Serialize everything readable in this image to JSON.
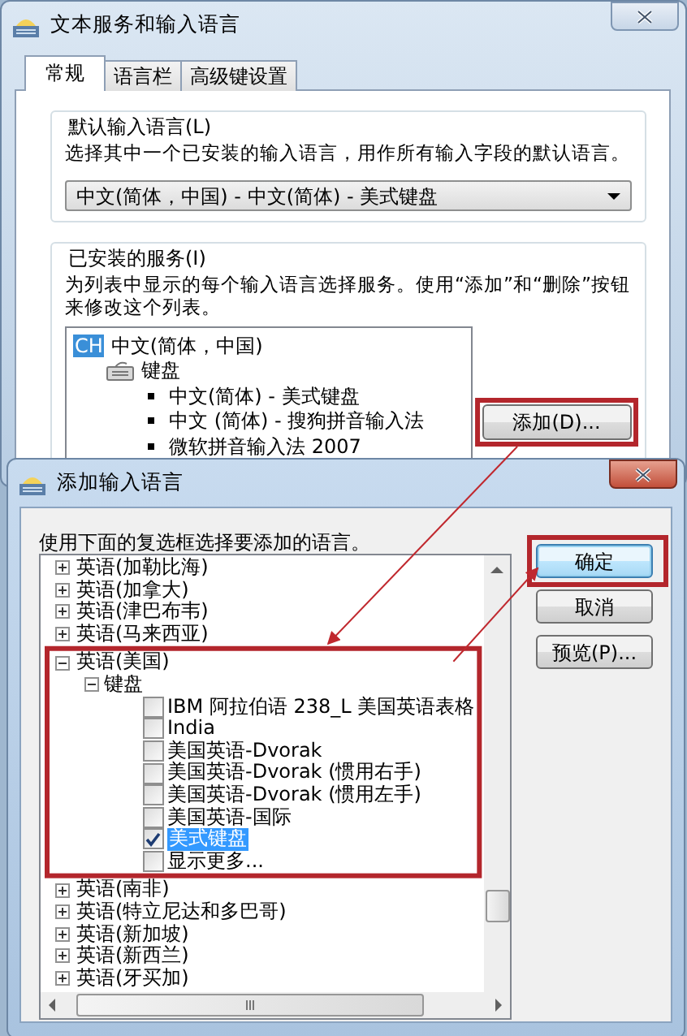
{
  "main_window": {
    "title": "文本服务和输入语言",
    "tabs": [
      {
        "label": "常规",
        "selected": true
      },
      {
        "label": "语言栏",
        "selected": false
      },
      {
        "label": "高级键设置",
        "selected": false
      }
    ],
    "default_language": {
      "heading": "默认输入语言(L)",
      "description": "选择其中一个已安装的输入语言，用作所有输入字段的默认语言。",
      "dropdown_value": "中文(简体，中国) - 中文(简体) - 美式键盘"
    },
    "installed_services": {
      "heading": "已安装的服务(I)",
      "description": "为列表中显示的每个输入语言选择服务。使用“添加”和“删除”按钮来修改这个列表。",
      "tree": [
        {
          "badge": "CH",
          "label": "中文(简体，中国)",
          "children": [
            {
              "label": "键盘",
              "children": [
                {
                  "label": "中文(简体) - 美式键盘"
                },
                {
                  "label": "中文 (简体) - 搜狗拼音输入法"
                },
                {
                  "label": "微软拼音输入法 2007"
                }
              ]
            }
          ]
        }
      ],
      "add_button": "添加(D)..."
    }
  },
  "add_dialog": {
    "title": "添加输入语言",
    "instruction": "使用下面的复选框选择要添加的语言。",
    "languages": [
      {
        "label": "英语(加勒比海)",
        "expanded": false
      },
      {
        "label": "英语(加拿大)",
        "expanded": false
      },
      {
        "label": "英语(津巴布韦)",
        "expanded": false
      },
      {
        "label": "英语(马来西亚)",
        "expanded": false
      },
      {
        "label": "英语(美国)",
        "expanded": true,
        "children": [
          {
            "label": "键盘",
            "expanded": true,
            "children": [
              {
                "label": "IBM 阿拉伯语 238_L 美国英语表格",
                "checked": false,
                "selected": false
              },
              {
                "label": "India",
                "checked": false,
                "selected": false
              },
              {
                "label": "美国英语-Dvorak",
                "checked": false,
                "selected": false
              },
              {
                "label": "美国英语-Dvorak (惯用右手)",
                "checked": false,
                "selected": false
              },
              {
                "label": "美国英语-Dvorak (惯用左手)",
                "checked": false,
                "selected": false
              },
              {
                "label": "美国英语-国际",
                "checked": false,
                "selected": false
              },
              {
                "label": "美式键盘",
                "checked": true,
                "selected": true
              },
              {
                "label": "显示更多...",
                "checked": false,
                "selected": false
              }
            ]
          }
        ]
      },
      {
        "label": "英语(南非)",
        "expanded": false
      },
      {
        "label": "英语(特立尼达和多巴哥)",
        "expanded": false
      },
      {
        "label": "英语(新加坡)",
        "expanded": false
      },
      {
        "label": "英语(新西兰)",
        "expanded": false
      },
      {
        "label": "英语(牙买加)",
        "expanded": false
      }
    ],
    "buttons": [
      {
        "label": "确定",
        "default": true
      },
      {
        "label": "取消",
        "default": false
      },
      {
        "label": "预览(P)...",
        "default": false
      }
    ]
  }
}
